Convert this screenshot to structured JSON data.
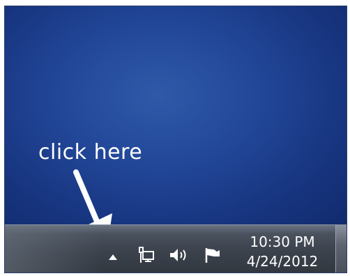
{
  "annotation": {
    "text": "click here"
  },
  "tray": {
    "show_hidden_icon": "up-triangle-icon",
    "network_icon": "network-icon",
    "volume_icon": "speaker-icon",
    "action_center_icon": "flag-icon"
  },
  "clock": {
    "time": "10:30 PM",
    "date": "4/24/2012"
  },
  "colors": {
    "desktop": "#1d3f8c",
    "taskbar": "#3b424c",
    "text": "#ffffff"
  }
}
